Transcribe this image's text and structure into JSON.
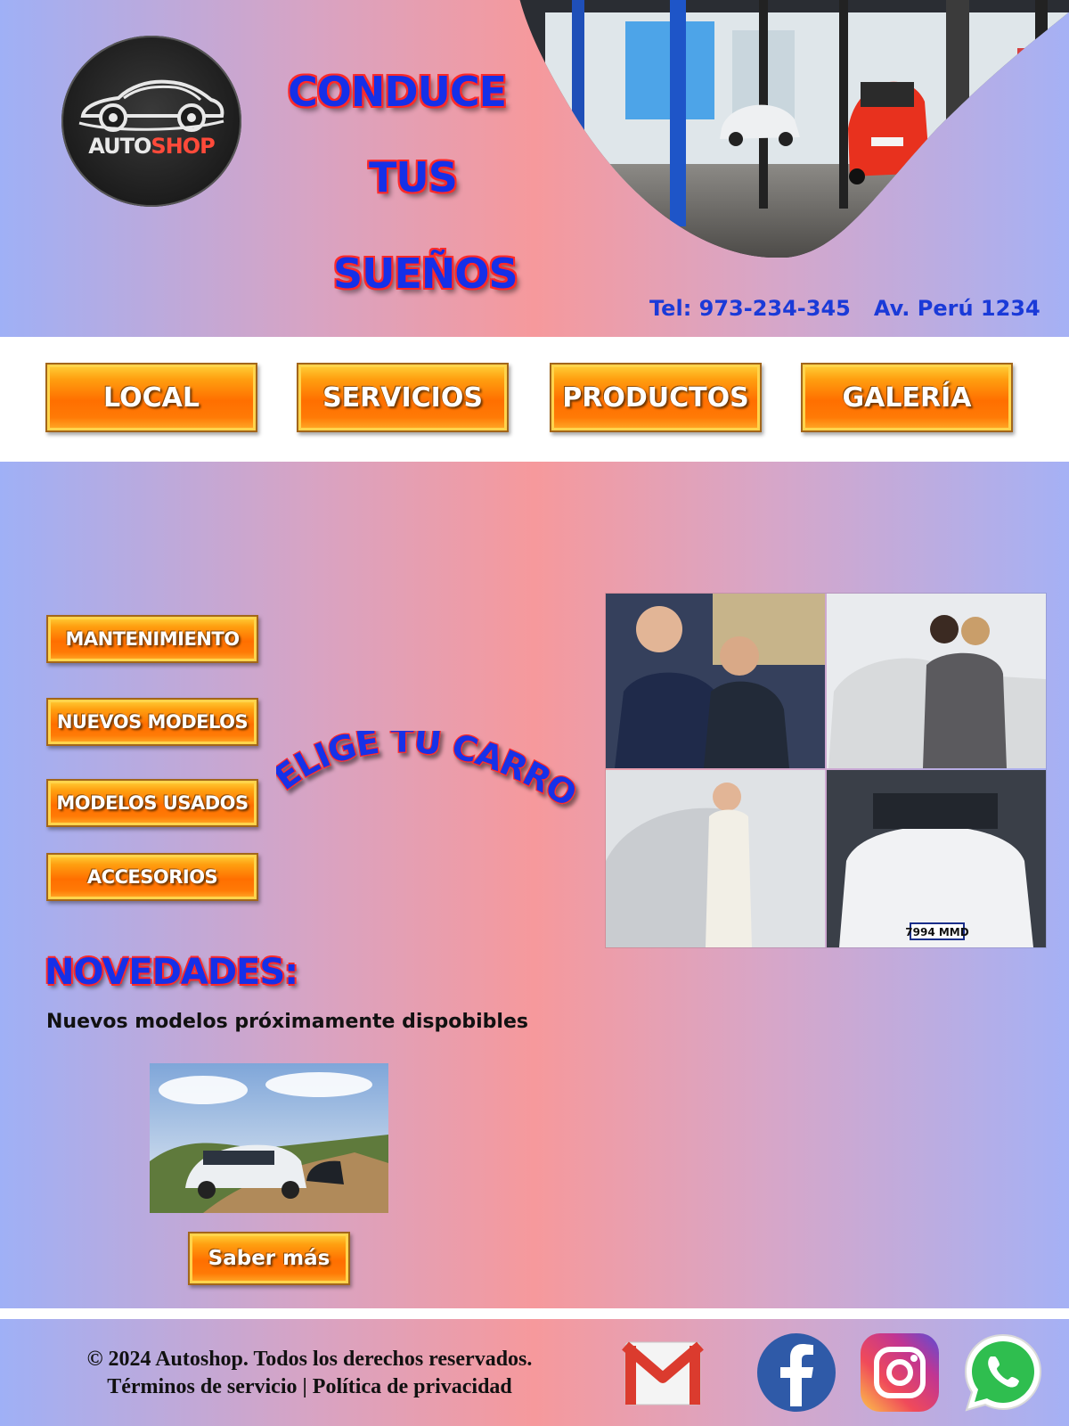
{
  "brand": {
    "logo_part1": "AUTO",
    "logo_part2": "SHOP"
  },
  "hero": {
    "line1": "CONDUCE",
    "line2": "TUS",
    "line3": "SUEÑOS"
  },
  "contact": {
    "phone": "Tel: 973-234-345",
    "address": "Av. Perú 1234"
  },
  "nav": {
    "items": [
      {
        "label": "LOCAL"
      },
      {
        "label": "SERVICIOS"
      },
      {
        "label": "PRODUCTOS"
      },
      {
        "label": "GALERÍA"
      }
    ]
  },
  "sidebar": {
    "items": [
      {
        "label": "MANTENIMIENTO"
      },
      {
        "label": "NUEVOS MODELOS"
      },
      {
        "label": "MODELOS USADOS"
      },
      {
        "label": "ACCESORIOS"
      }
    ]
  },
  "main": {
    "tagline": "ELIGE TU CARRO",
    "news_title": "NOVEDADES:",
    "news_text": "Nuevos modelos próximamente dispobibles",
    "more_button": "Saber más",
    "plate_collage": "7994 MMD"
  },
  "footer": {
    "copyright": "© 2024 Autoshop. Todos los derechos reservados.",
    "links": "Términos de servicio | Política de privacidad",
    "social": [
      "gmail-icon",
      "facebook-icon",
      "instagram-icon",
      "whatsapp-icon"
    ]
  },
  "colors": {
    "accent_blue": "#1530e8",
    "accent_red": "#ff2a2a",
    "button_orange": "#ff7a06",
    "gradient_pink": "#f6999c",
    "gradient_blue": "#9fb0f6"
  }
}
